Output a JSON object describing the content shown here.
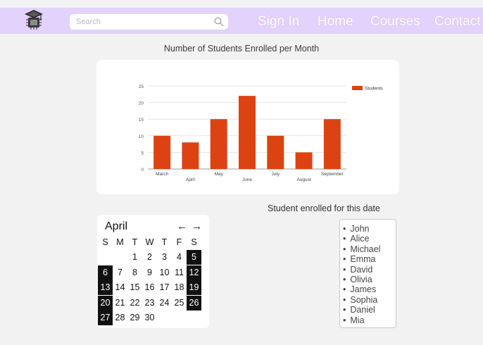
{
  "navbar": {
    "search_placeholder": "Search",
    "links": [
      "Sign In",
      "Home",
      "Courses",
      "Contact"
    ],
    "logo_icon": "graduation-cap-chip-icon",
    "search_icon": "search-icon",
    "background": "#e3d2fb"
  },
  "chart_title": "Number of Students Enrolled per Month",
  "chart_data": {
    "type": "bar",
    "categories": [
      "March",
      "April",
      "May",
      "June",
      "July",
      "August",
      "September"
    ],
    "series": [
      {
        "name": "Students",
        "values": [
          10,
          8,
          15,
          22,
          10,
          5,
          15
        ],
        "color": "#dd4312"
      }
    ],
    "ylim": [
      0,
      25
    ],
    "yticks": [
      0,
      5,
      10,
      15,
      20,
      25
    ],
    "grid": true,
    "legend": "top-right"
  },
  "enrolled_title": "Student enrolled for this date",
  "calendar": {
    "month": "April",
    "prev_icon": "arrow-left-icon",
    "next_icon": "arrow-right-icon",
    "prev_glyph": "←",
    "next_glyph": "→",
    "weekdays": [
      "S",
      "M",
      "T",
      "W",
      "T",
      "F",
      "S"
    ],
    "weeks": [
      [
        "",
        "",
        "1",
        "2",
        "3",
        "4",
        "5"
      ],
      [
        "6",
        "7",
        "8",
        "9",
        "10",
        "11",
        "12"
      ],
      [
        "13",
        "14",
        "15",
        "16",
        "17",
        "18",
        "19"
      ],
      [
        "20",
        "21",
        "22",
        "23",
        "24",
        "25",
        "26"
      ],
      [
        "27",
        "28",
        "29",
        "30",
        "",
        "",
        ""
      ]
    ],
    "highlight_color": "#111111"
  },
  "students": [
    "John",
    "Alice",
    "Michael",
    "Emma",
    "David",
    "Olivia",
    "James",
    "Sophia",
    "Daniel",
    "Mia"
  ]
}
